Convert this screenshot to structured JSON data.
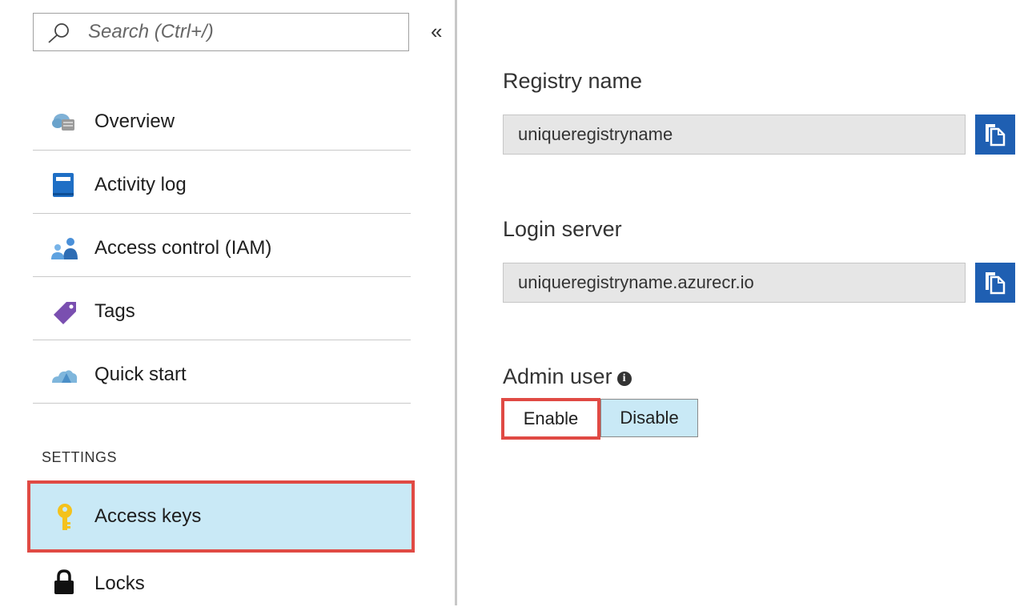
{
  "search": {
    "placeholder": "Search (Ctrl+/)",
    "collapse_glyph": "«"
  },
  "nav": {
    "items": [
      {
        "label": "Overview",
        "icon": "cloud-server-icon"
      },
      {
        "label": "Activity log",
        "icon": "activity-log-icon"
      },
      {
        "label": "Access control (IAM)",
        "icon": "users-icon"
      },
      {
        "label": "Tags",
        "icon": "tag-icon"
      },
      {
        "label": "Quick start",
        "icon": "quick-start-cloud-icon"
      }
    ],
    "section_label": "SETTINGS",
    "selected_item": {
      "label": "Access keys",
      "icon": "key-icon"
    },
    "after_items": [
      {
        "label": "Locks",
        "icon": "lock-icon"
      }
    ]
  },
  "content": {
    "registry_name": {
      "label": "Registry name",
      "value": "uniqueregistryname"
    },
    "login_server": {
      "label": "Login server",
      "value": "uniqueregistryname.azurecr.io"
    },
    "admin_user": {
      "label": "Admin user",
      "info_glyph": "i",
      "enable_label": "Enable",
      "disable_label": "Disable",
      "selected": "Disable"
    }
  },
  "colors": {
    "accent_blue": "#1f5fb2",
    "selected_bg": "#c9e9f6",
    "highlight_red": "#e04a44"
  }
}
